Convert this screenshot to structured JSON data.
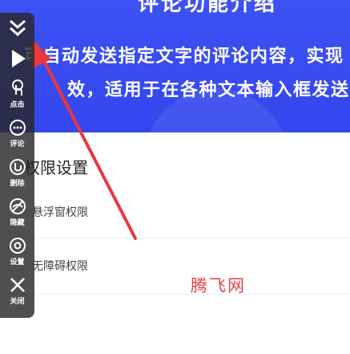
{
  "banner": {
    "title": "评论功能介绍",
    "line1": "可自动发送指定文字的评论内容，实现",
    "line2": "效，适用于在各种文本输入框发送文字"
  },
  "section": {
    "title": "权限设置",
    "row1": "悬浮窗权限",
    "row2": "无障碍权限"
  },
  "watermark": "腾飞网",
  "colors": {
    "banner": "#3c52f3",
    "arrow": "#e8383d",
    "toolbar": "#282828",
    "watermark": "#e04545"
  },
  "toolbar": {
    "items": [
      {
        "icon": "collapse-chevrons-icon",
        "label": ""
      },
      {
        "icon": "play-icon",
        "label": ""
      },
      {
        "icon": "finger-tap-icon",
        "label": "点击"
      },
      {
        "icon": "comment-icon",
        "label": "评论"
      },
      {
        "icon": "delete-hand-icon",
        "label": "删除"
      },
      {
        "icon": "hide-eye-icon",
        "label": "隐藏"
      },
      {
        "icon": "settings-icon",
        "label": "设置"
      },
      {
        "icon": "close-icon",
        "label": "关闭"
      }
    ]
  }
}
